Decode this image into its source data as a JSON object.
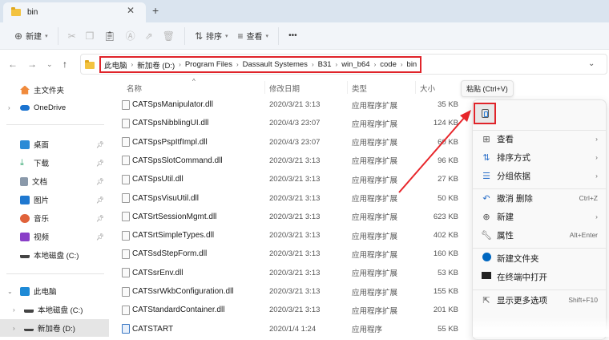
{
  "tab": {
    "title": "bin"
  },
  "toolbar": {
    "new": "新建",
    "sort": "排序",
    "view": "查看",
    "more": "•••"
  },
  "breadcrumb": [
    "此电脑",
    "新加卷 (D:)",
    "Program Files",
    "Dassault Systemes",
    "B31",
    "win_b64",
    "code",
    "bin"
  ],
  "sidebar": {
    "home": "主文件夹",
    "onedrive": "OneDrive",
    "desktop": "桌面",
    "downloads": "下载",
    "documents": "文档",
    "pictures": "图片",
    "music": "音乐",
    "videos": "视频",
    "local_c": "本地磁盘 (C:)",
    "this_pc": "此电脑",
    "pc_c": "本地磁盘 (C:)",
    "pc_d": "新加卷 (D:)"
  },
  "columns": {
    "name": "名称",
    "date": "修改日期",
    "type": "类型",
    "size": "大小"
  },
  "files": [
    {
      "name": "CATSpsManipulator.dll",
      "date": "2020/3/21 3:13",
      "type": "应用程序扩展",
      "size": "35 KB"
    },
    {
      "name": "CATSpsNibblingUI.dll",
      "date": "2020/4/3 23:07",
      "type": "应用程序扩展",
      "size": "124 KB"
    },
    {
      "name": "CATSpsPspItfImpl.dll",
      "date": "2020/4/3 23:07",
      "type": "应用程序扩展",
      "size": "60 KB"
    },
    {
      "name": "CATSpsSlotCommand.dll",
      "date": "2020/3/21 3:13",
      "type": "应用程序扩展",
      "size": "96 KB"
    },
    {
      "name": "CATSpsUtil.dll",
      "date": "2020/3/21 3:13",
      "type": "应用程序扩展",
      "size": "27 KB"
    },
    {
      "name": "CATSpsVisuUtil.dll",
      "date": "2020/3/21 3:13",
      "type": "应用程序扩展",
      "size": "50 KB"
    },
    {
      "name": "CATSrtSessionMgmt.dll",
      "date": "2020/3/21 3:13",
      "type": "应用程序扩展",
      "size": "623 KB"
    },
    {
      "name": "CATSrtSimpleTypes.dll",
      "date": "2020/3/21 3:13",
      "type": "应用程序扩展",
      "size": "402 KB"
    },
    {
      "name": "CATSsdStepForm.dll",
      "date": "2020/3/21 3:13",
      "type": "应用程序扩展",
      "size": "160 KB"
    },
    {
      "name": "CATSsrEnv.dll",
      "date": "2020/3/21 3:13",
      "type": "应用程序扩展",
      "size": "53 KB"
    },
    {
      "name": "CATSsrWkbConfiguration.dll",
      "date": "2020/3/21 3:13",
      "type": "应用程序扩展",
      "size": "155 KB"
    },
    {
      "name": "CATStandardContainer.dll",
      "date": "2020/3/21 3:13",
      "type": "应用程序扩展",
      "size": "201 KB"
    },
    {
      "name": "CATSTART",
      "date": "2020/1/4 1:24",
      "type": "应用程序",
      "size": "55 KB"
    }
  ],
  "tooltip": "粘贴 (Ctrl+V)",
  "menu": {
    "view": "查看",
    "sort": "排序方式",
    "group": "分组依据",
    "undo": "撤消 删除",
    "undo_sc": "Ctrl+Z",
    "new": "新建",
    "props": "属性",
    "props_sc": "Alt+Enter",
    "new_folder": "新建文件夹",
    "terminal": "在终端中打开",
    "more": "显示更多选项",
    "more_sc": "Shift+F10"
  },
  "colors": {
    "highlight": "#e0242a",
    "accent": "#0067c0"
  }
}
